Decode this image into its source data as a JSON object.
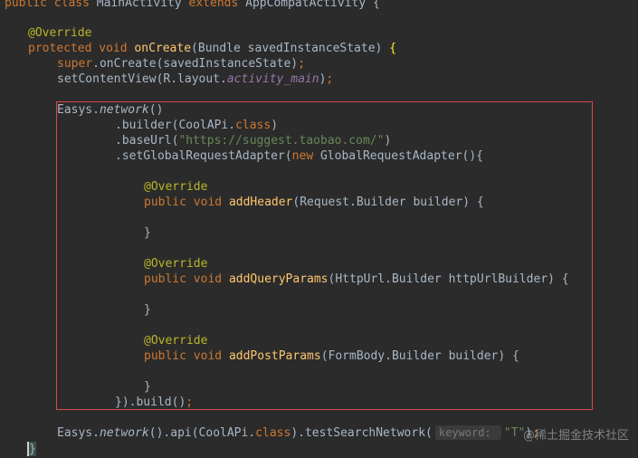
{
  "code": {
    "l0": {
      "kw1": "public",
      "kw2": "class",
      "name": "MainActivity",
      "kw3": "extends",
      "parent": "AppCompatActivity",
      "brace": "{"
    },
    "l1": {
      "annotation": "@Override"
    },
    "l2": {
      "kw1": "protected",
      "kw2": "void",
      "method": "onCreate",
      "params": "(Bundle savedInstanceState)",
      "brace": "{"
    },
    "l3": {
      "kw": "super",
      "rest": ".onCreate(savedInstanceState)",
      "semi": ";"
    },
    "l4": {
      "pre": "setContentView(R.layout.",
      "field": "activity_main",
      "post": ")",
      "semi": ";"
    },
    "l5": {
      "pre": "Easys.",
      "method": "network",
      "post": "()"
    },
    "l6": {
      "pre": ".builder(CoolAPi.",
      "kw": "class",
      "post": ")"
    },
    "l7": {
      "pre": ".baseUrl(",
      "str": "\"https://suggest.taobao.com/\"",
      "post": ")"
    },
    "l8": {
      "pre": ".setGlobalRequestAdapter(",
      "kw": "new",
      "post": " GlobalRequestAdapter(){"
    },
    "l9": {
      "annotation": "@Override"
    },
    "l10": {
      "kw1": "public",
      "kw2": "void",
      "method": "addHeader",
      "params": "(Request.Builder builder) {"
    },
    "l11": {
      "brace": "}"
    },
    "l12": {
      "annotation": "@Override"
    },
    "l13": {
      "kw1": "public",
      "kw2": "void",
      "method": "addQueryParams",
      "params": "(HttpUrl.Builder httpUrlBuilder) {"
    },
    "l14": {
      "brace": "}"
    },
    "l15": {
      "annotation": "@Override"
    },
    "l16": {
      "kw1": "public",
      "kw2": "void",
      "method": "addPostParams",
      "params": "(FormBody.Builder builder) {"
    },
    "l17": {
      "brace": "}"
    },
    "l18": {
      "text": "}).build()",
      "semi": ";"
    },
    "l19": {
      "pre": "Easys.",
      "method": "network",
      "mid": "().api(CoolAPi.",
      "kw": "class",
      "post": ").testSearchNetwork(",
      "hint": "keyword: ",
      "arg": "\"T\"",
      "end": ")",
      "semi": ";"
    },
    "l20": {
      "brace": "}"
    }
  },
  "watermark": "@稀土掘金技术社区",
  "colors": {
    "background": "#2b2b2b",
    "keyword": "#cc7832",
    "method": "#ffc66d",
    "annotation": "#bbb529",
    "string": "#6a8759",
    "field": "#9876aa",
    "highlight_border": "#d84a4a"
  }
}
